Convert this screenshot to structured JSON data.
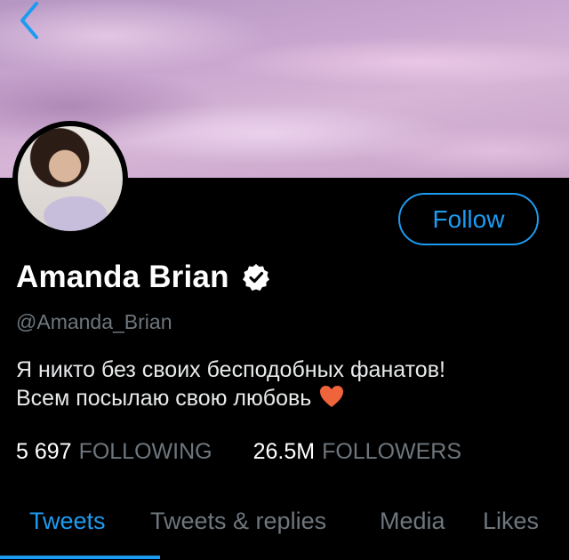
{
  "header": {
    "back_icon": "chevron-left-icon"
  },
  "profile": {
    "name": "Amanda Brian",
    "verified_icon": "verified-badge-icon",
    "handle": "@Amanda_Brian",
    "follow_label": "Follow",
    "bio_lines": [
      "Я никто без своих бесподобных фанатов!",
      "Всем посылаю свою любовь"
    ],
    "bio_emoji": "heart-icon",
    "following_count": "5 697",
    "following_label": "FOLLOWING",
    "followers_count": "26.5M",
    "followers_label": "FOLLOWERS"
  },
  "tabs": [
    {
      "label": "Tweets",
      "active": true
    },
    {
      "label": "Tweets & replies",
      "active": false
    },
    {
      "label": "Media",
      "active": false
    },
    {
      "label": "Likes",
      "active": false
    }
  ],
  "colors": {
    "accent": "#1d9bf0",
    "background": "#000000",
    "muted": "#6e767d"
  }
}
